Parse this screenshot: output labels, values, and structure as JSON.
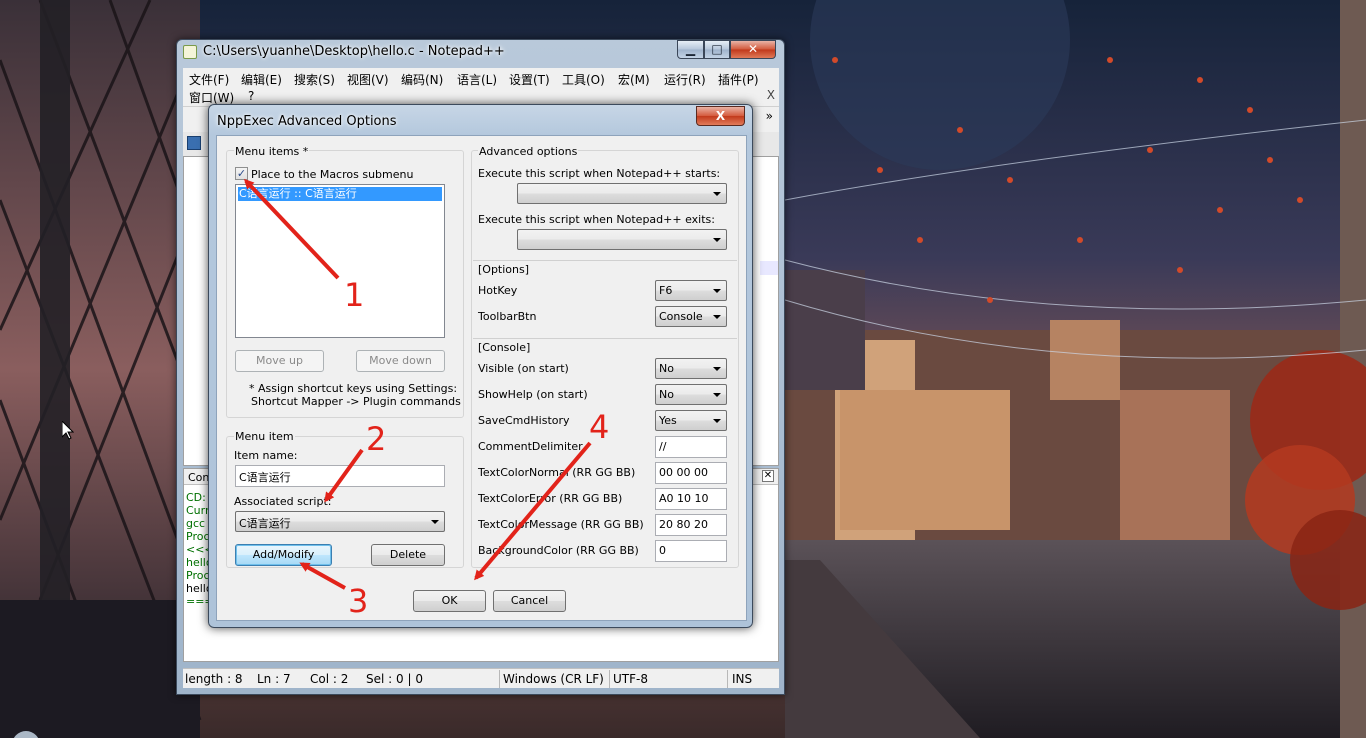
{
  "notepad": {
    "title": "C:\\Users\\yuanhe\\Desktop\\hello.c - Notepad++",
    "menu": [
      "文件(F)",
      "编辑(E)",
      "搜索(S)",
      "视图(V)",
      "编码(N)",
      "语言(L)",
      "设置(T)",
      "工具(O)",
      "宏(M)",
      "运行(R)",
      "插件(P)",
      "窗口(W)",
      "?"
    ],
    "menu_close": "X",
    "toolbar_overflow": "»",
    "console_tab": "Con",
    "console_lines": [
      "CD: C",
      "Curre",
      "gcc -",
      "Proce",
      "<<< ",
      "hello",
      "Proce",
      "hello",
      "===="
    ],
    "status": {
      "length": "length : 8",
      "ln": "Ln : 7",
      "col": "Col : 2",
      "sel": "Sel : 0 | 0",
      "eol": "Windows (CR LF)",
      "encoding": "UTF-8",
      "mode": "INS"
    }
  },
  "dialog": {
    "title": "NppExec Advanced Options",
    "close": "X",
    "menu_items": {
      "group_label": "Menu items *",
      "checkbox_label": "Place to the Macros submenu",
      "checkbox_checked": true,
      "list": [
        "C语言运行 :: C语言运行"
      ],
      "move_up": "Move up",
      "move_down": "Move down",
      "note_line1": "* Assign shortcut keys using Settings:",
      "note_line2": "Shortcut Mapper -> Plugin commands"
    },
    "menu_item": {
      "group_label": "Menu item",
      "item_name_label": "Item name:",
      "item_name_value": "C语言运行",
      "assoc_label": "Associated script:",
      "assoc_value": "C语言运行",
      "add_modify": "Add/Modify",
      "delete": "Delete"
    },
    "advanced": {
      "group_label": "Advanced options",
      "start_label": "Execute this script when Notepad++ starts:",
      "start_value": "",
      "exit_label": "Execute this script when Notepad++ exits:",
      "exit_value": "",
      "options_header": "[Options]",
      "hotkey_label": "HotKey",
      "hotkey_value": "F6",
      "toolbarbtn_label": "ToolbarBtn",
      "toolbarbtn_value": "Console",
      "console_header": "[Console]",
      "visible_label": "Visible (on start)",
      "visible_value": "No",
      "showhelp_label": "ShowHelp (on start)",
      "showhelp_value": "No",
      "savecmd_label": "SaveCmdHistory",
      "savecmd_value": "Yes",
      "commentdelim_label": "CommentDelimiter",
      "commentdelim_value": "//",
      "tcnormal_label": "TextColorNormal (RR GG BB)",
      "tcnormal_value": "00 00 00",
      "tcerror_label": "TextColorError (RR GG BB)",
      "tcerror_value": "A0 10 10",
      "tcmessage_label": "TextColorMessage (RR GG BB)",
      "tcmessage_value": "20 80 20",
      "bgcolor_label": "BackgroundColor (RR GG BB)",
      "bgcolor_value": "0"
    },
    "ok": "OK",
    "cancel": "Cancel"
  },
  "annotations": [
    "1",
    "2",
    "3",
    "4"
  ],
  "colors": {
    "annotation_red": "#e2231a",
    "selection_blue": "#3399ff",
    "console_green": "#007000"
  },
  "icons": [
    "notepad-app-icon",
    "minimize-icon",
    "maximize-icon",
    "close-icon",
    "checkbox-check-icon",
    "dropdown-arrow-icon",
    "mouse-cursor-icon"
  ]
}
